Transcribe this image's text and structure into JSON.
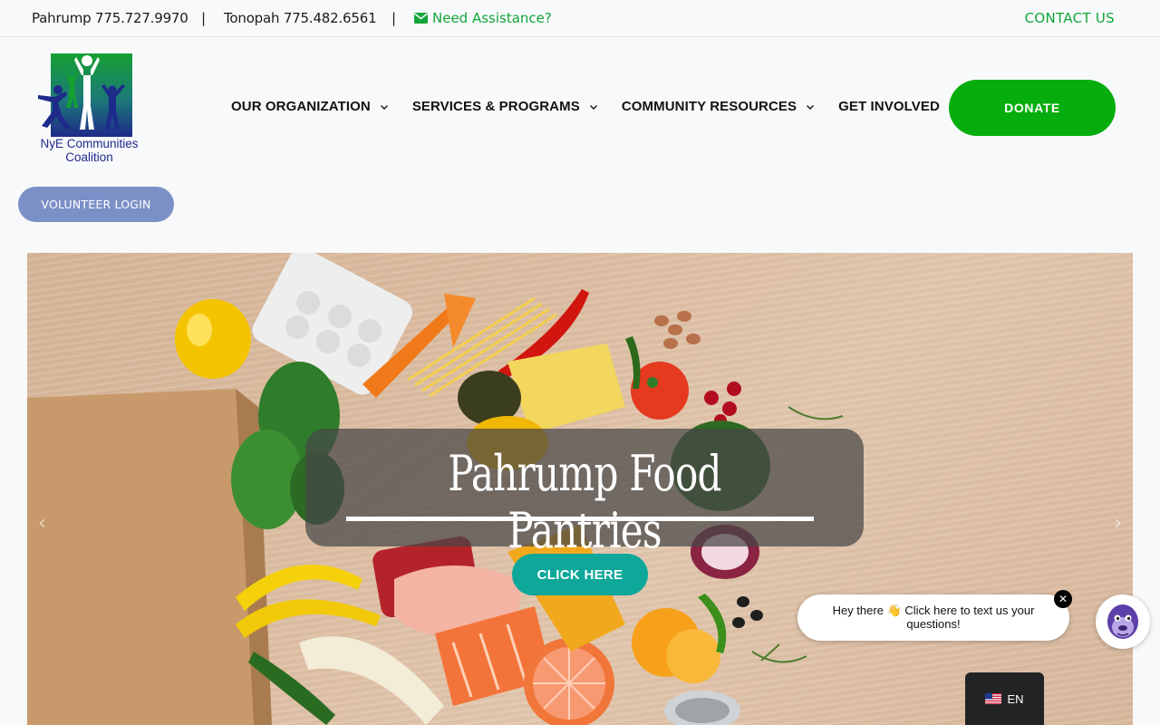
{
  "topbar": {
    "pahrump_phone": "Pahrump 775.727.9970",
    "separator": "|",
    "tonopah_phone": "Tonopah 775.482.6561",
    "assistance": "Need Assistance?",
    "contact_us": "CONTACT US"
  },
  "logo": {
    "line1": "NyE Communities",
    "line2": "Coalition"
  },
  "nav": {
    "items": [
      {
        "label": "OUR ORGANIZATION"
      },
      {
        "label": "SERVICES & PROGRAMS"
      },
      {
        "label": "COMMUNITY RESOURCES"
      },
      {
        "label": "GET INVOLVED"
      }
    ],
    "donate": "DONATE",
    "volunteer_login": "VOLUNTEER LOGIN"
  },
  "hero": {
    "title": "Pahrump Food Pantries",
    "button": "CLICK HERE",
    "prev_arrow": "‹",
    "next_arrow": "›"
  },
  "chat": {
    "message": "Hey there 👋 Click here to text us your questions!",
    "close": "✕"
  },
  "language": {
    "code": "EN"
  },
  "colors": {
    "accent_green": "#13a538",
    "donate_green": "#06ad0d",
    "volunteer_blue": "#7c90c8",
    "cta_teal": "#0ea79a"
  }
}
